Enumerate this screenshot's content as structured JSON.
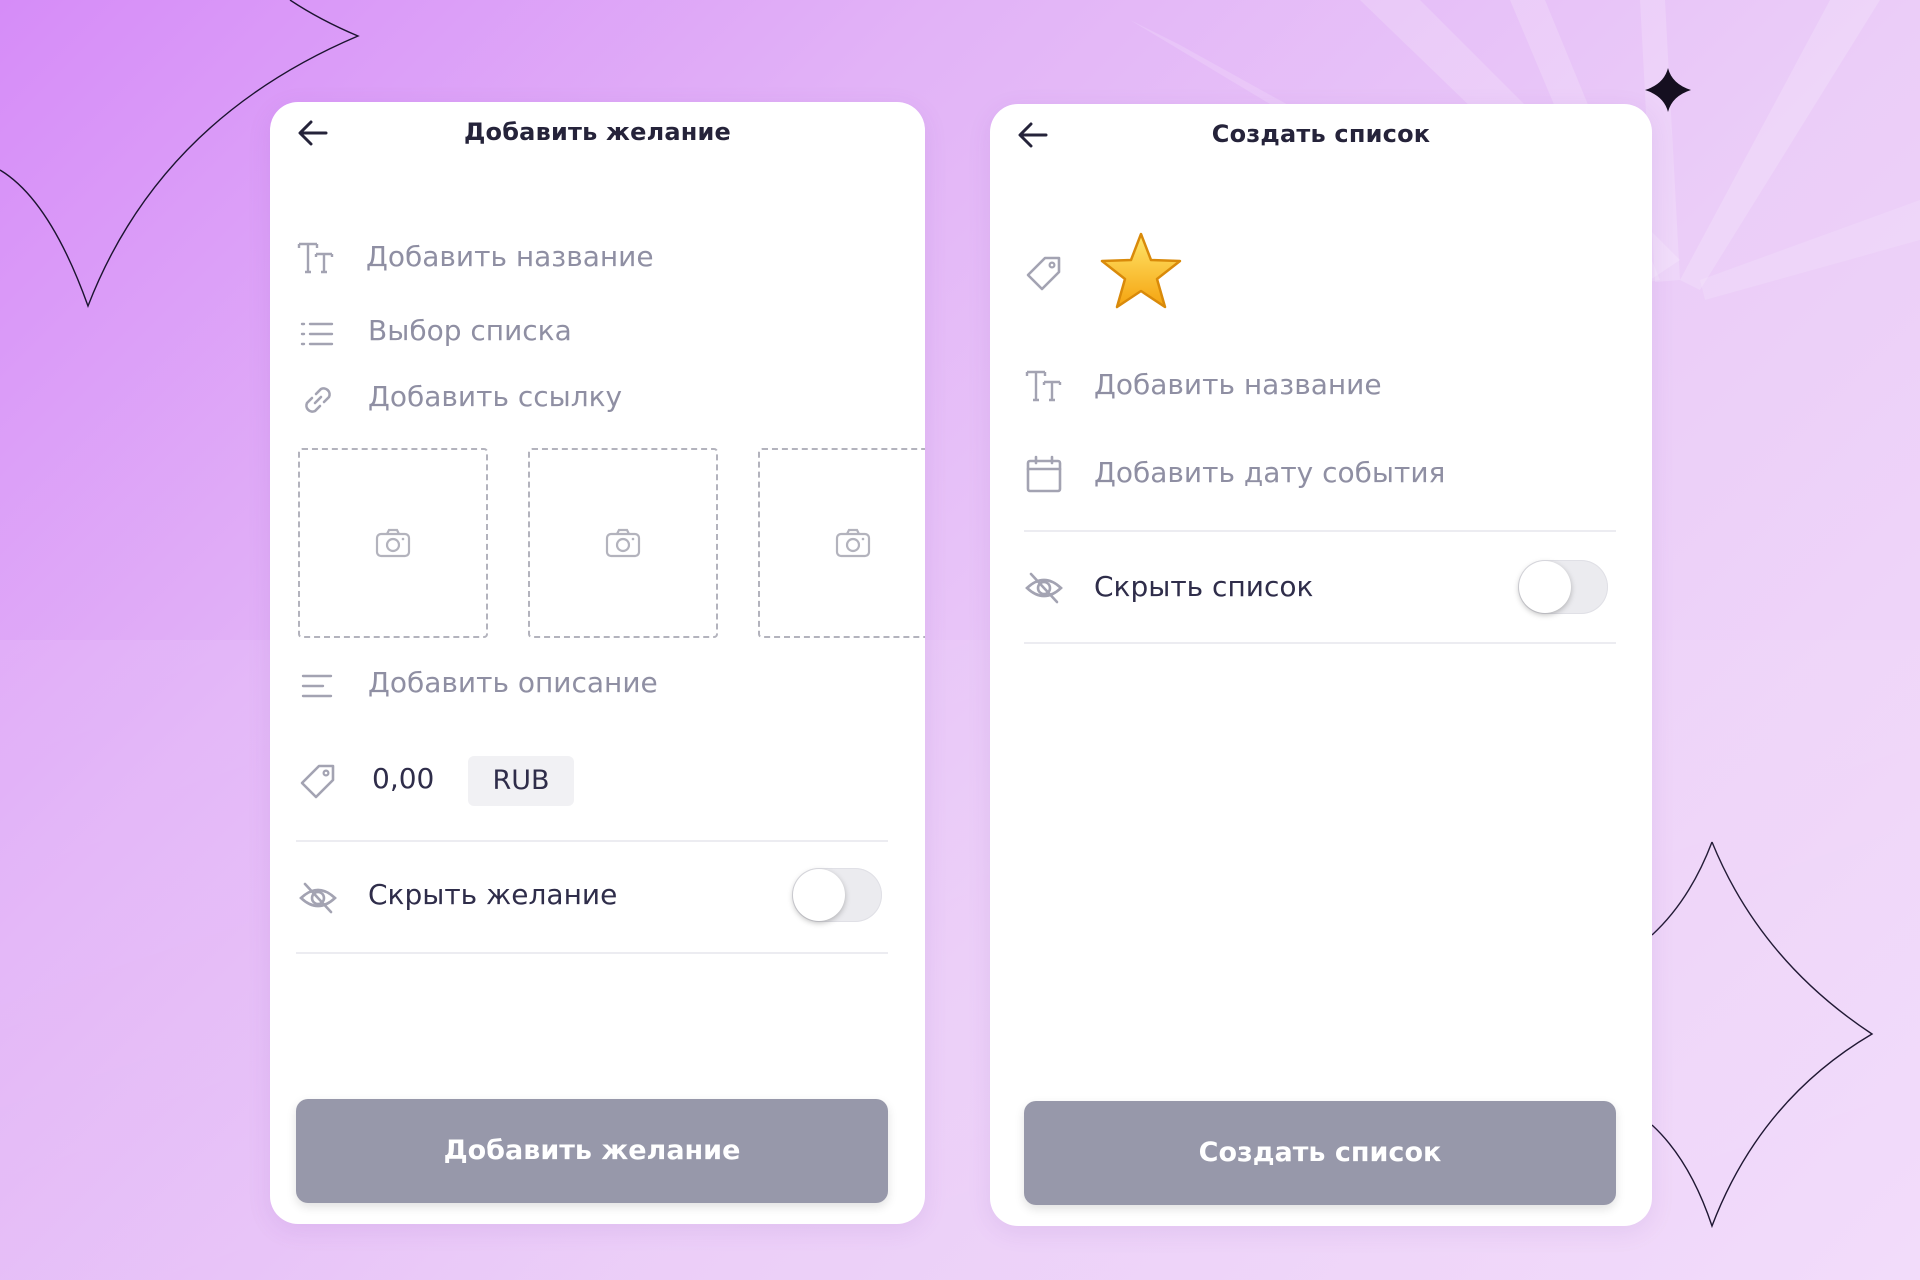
{
  "colors": {
    "background_gradient": [
      "#d68cf8",
      "#f2dcfa"
    ],
    "card_background": "#ffffff",
    "title_text": "#25233a",
    "placeholder_text": "#8f8fa3",
    "primary_button": "#9798aa",
    "toggle_off": "#ebebef"
  },
  "wish_screen": {
    "title": "Добавить желание",
    "back_icon": "arrow-left-icon",
    "fields": {
      "name_placeholder": "Добавить название",
      "list_placeholder": "Выбор списка",
      "link_placeholder": "Добавить ссылку",
      "description_placeholder": "Добавить описание",
      "price_value": "0,00",
      "currency": "RUB"
    },
    "photo_slot_icon": "camera-icon",
    "hide_label": "Скрыть желание",
    "hide_enabled": false,
    "submit_label": "Добавить желание"
  },
  "list_screen": {
    "title": "Создать список",
    "back_icon": "arrow-left-icon",
    "selected_emoji": "⭐",
    "fields": {
      "name_placeholder": "Добавить название",
      "date_placeholder": "Добавить дату события"
    },
    "hide_label": "Скрыть список",
    "hide_enabled": false,
    "submit_label": "Создать список"
  }
}
